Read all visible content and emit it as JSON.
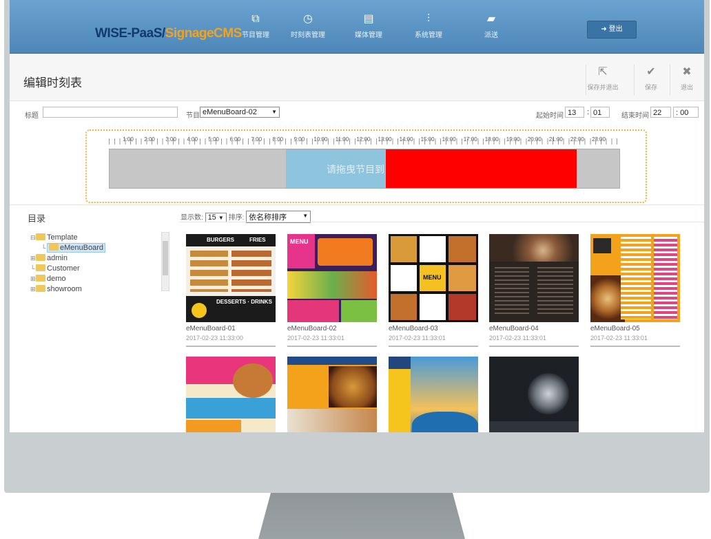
{
  "brand": {
    "part1": "WISE-PaaS/",
    "part2": "SignageCMS"
  },
  "nav": [
    {
      "label": "节目管理",
      "icon": "layers-icon"
    },
    {
      "label": "时刻表管理",
      "icon": "clock-icon"
    },
    {
      "label": "媒体管理",
      "icon": "media-icon"
    },
    {
      "label": "系统管理",
      "icon": "sliders-icon"
    },
    {
      "label": "派送",
      "icon": "video-icon"
    }
  ],
  "logout_label": "登出",
  "page_title": "编辑时刻表",
  "toolbar": {
    "save_exit": "保存并退出",
    "save": "保存",
    "exit": "退出"
  },
  "filters": {
    "title_label": "标题",
    "title_value": "",
    "program_label": "节目",
    "program_value": "eMenuBoard-02",
    "start_label": "起始时间",
    "start_hour": "13",
    "start_min": "01",
    "end_label": "结束时间",
    "end_hour": "22",
    "end_min": "00"
  },
  "timeline": {
    "hours": [
      "1:00",
      "2:00",
      "3:00",
      "4:00",
      "5:00",
      "6:00",
      "7:00",
      "8:00",
      "9:00",
      "10:00",
      "11:00",
      "12:00",
      "13:00",
      "14:00",
      "15:00",
      "16:00",
      "17:00",
      "18:00",
      "19:00",
      "20:00",
      "21:00",
      "22:00",
      "23:00"
    ],
    "drop_hint": "请拖曳节目到",
    "segments": [
      {
        "start": 8.3,
        "end": 13.0,
        "color": "#8fc4de"
      },
      {
        "start": 13.0,
        "end": 22.0,
        "color": "#ff0000"
      }
    ]
  },
  "directory": {
    "title": "目录",
    "tree": [
      {
        "label": "Template",
        "level": 0,
        "expand": "⊟"
      },
      {
        "label": "eMenuBoard",
        "level": 1,
        "expand": "",
        "selected": true
      },
      {
        "label": "admin",
        "level": 0,
        "expand": "⊞"
      },
      {
        "label": "Customer",
        "level": 0,
        "expand": ""
      },
      {
        "label": "demo",
        "level": 0,
        "expand": "⊞"
      },
      {
        "label": "showroom",
        "level": 0,
        "expand": "⊞"
      }
    ]
  },
  "pager": {
    "display_label": "显示数",
    "display_value": "15",
    "sort_label": "排序",
    "sort_value": "依名称排序"
  },
  "programs": [
    {
      "name": "eMenuBoard-01",
      "date": "2017-02-23 11:33:00"
    },
    {
      "name": "eMenuBoard-02",
      "date": "2017-02-23 11:33:01"
    },
    {
      "name": "eMenuBoard-03",
      "date": "2017-02-23 11:33:01"
    },
    {
      "name": "eMenuBoard-04",
      "date": "2017-02-23 11:33:01"
    },
    {
      "name": "eMenuBoard-05",
      "date": "2017-02-23 11:33:01"
    },
    {
      "name": "",
      "date": ""
    },
    {
      "name": "",
      "date": ""
    },
    {
      "name": "",
      "date": ""
    },
    {
      "name": "",
      "date": ""
    }
  ],
  "colors": {
    "header": "#5591c2",
    "accent": "#f4a21b",
    "timeline_blue": "#8fc4de",
    "timeline_red": "#ff0000"
  }
}
